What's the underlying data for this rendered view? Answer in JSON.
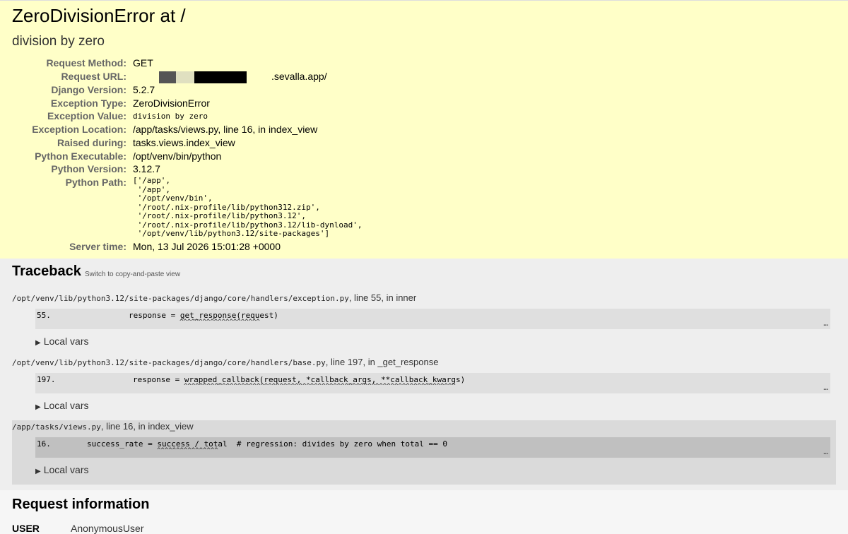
{
  "summary": {
    "title": "ZeroDivisionError at /",
    "subtitle": "division by zero",
    "rows": [
      {
        "key": "Request Method:",
        "value": "GET"
      },
      {
        "key": "Request URL:",
        "value": ".sevalla.app/"
      },
      {
        "key": "Django Version:",
        "value": "5.2.7"
      },
      {
        "key": "Exception Type:",
        "value": "ZeroDivisionError"
      },
      {
        "key": "Exception Value:",
        "value": "division by zero"
      },
      {
        "key": "Exception Location:",
        "value": "/app/tasks/views.py, line 16, in index_view"
      },
      {
        "key": "Raised during:",
        "value": "tasks.views.index_view"
      },
      {
        "key": "Python Executable:",
        "value": "/opt/venv/bin/python"
      },
      {
        "key": "Python Version:",
        "value": "3.12.7"
      },
      {
        "key": "Python Path:",
        "value": ""
      },
      {
        "key": "Server time:",
        "value": "Mon, 13 Jul 2026 15:01:28 +0000"
      }
    ],
    "python_path": [
      "['/app',",
      " '/app',",
      " '/opt/venv/bin',",
      " '/root/.nix-profile/lib/python312.zip',",
      " '/root/.nix-profile/lib/python3.12',",
      " '/root/.nix-profile/lib/python3.12/lib-dynload',",
      " '/opt/venv/lib/python3.12/site-packages']"
    ],
    "redaction_colors": [
      "#555555",
      "#e0e0c0",
      "#000000"
    ]
  },
  "traceback": {
    "heading": "Traceback",
    "switch_link": "Switch to copy-and-paste view",
    "frames": [
      {
        "file": "/opt/venv/lib/python3.12/site-packages/django/core/handlers/exception.py",
        "suffix": ", line 55, in inner",
        "lineno": "55.",
        "code": "response = get_response(request)",
        "carets": "^^^^^^^^^^^^^^^^^^^^^",
        "ellipsis": "…",
        "local_vars": "Local vars"
      },
      {
        "file": "/opt/venv/lib/python3.12/site-packages/django/core/handlers/base.py",
        "suffix": ", line 197, in _get_response",
        "lineno": "197.",
        "code": "response = wrapped_callback(request, *callback_args, **callback_kwargs)",
        "carets": "^^^^^^^^^^^^^^^^^^^^^^^^^^^^^^^^^^^^^^^^^^^^^^^^^^^^^^^^^^^^^^^^^^^^^^^",
        "ellipsis": "…",
        "local_vars": "Local vars"
      },
      {
        "file": "/app/tasks/views.py",
        "suffix": ", line 16, in index_view",
        "lineno": "16.",
        "code": "success_rate = success / total  # regression: divides by zero when total == 0",
        "carets": "^^^^^^^^^^^^^^^^",
        "ellipsis": "…",
        "local_vars": "Local vars"
      }
    ]
  },
  "request_info": {
    "heading": "Request information",
    "user_label": "USER",
    "user_value": "AnonymousUser"
  },
  "colors": {
    "summary_bg": "#ffffc8",
    "traceback_bg": "#eeeeee",
    "code_bg": "#dfdfdf",
    "user_code_bg": "#c0c0c0"
  }
}
